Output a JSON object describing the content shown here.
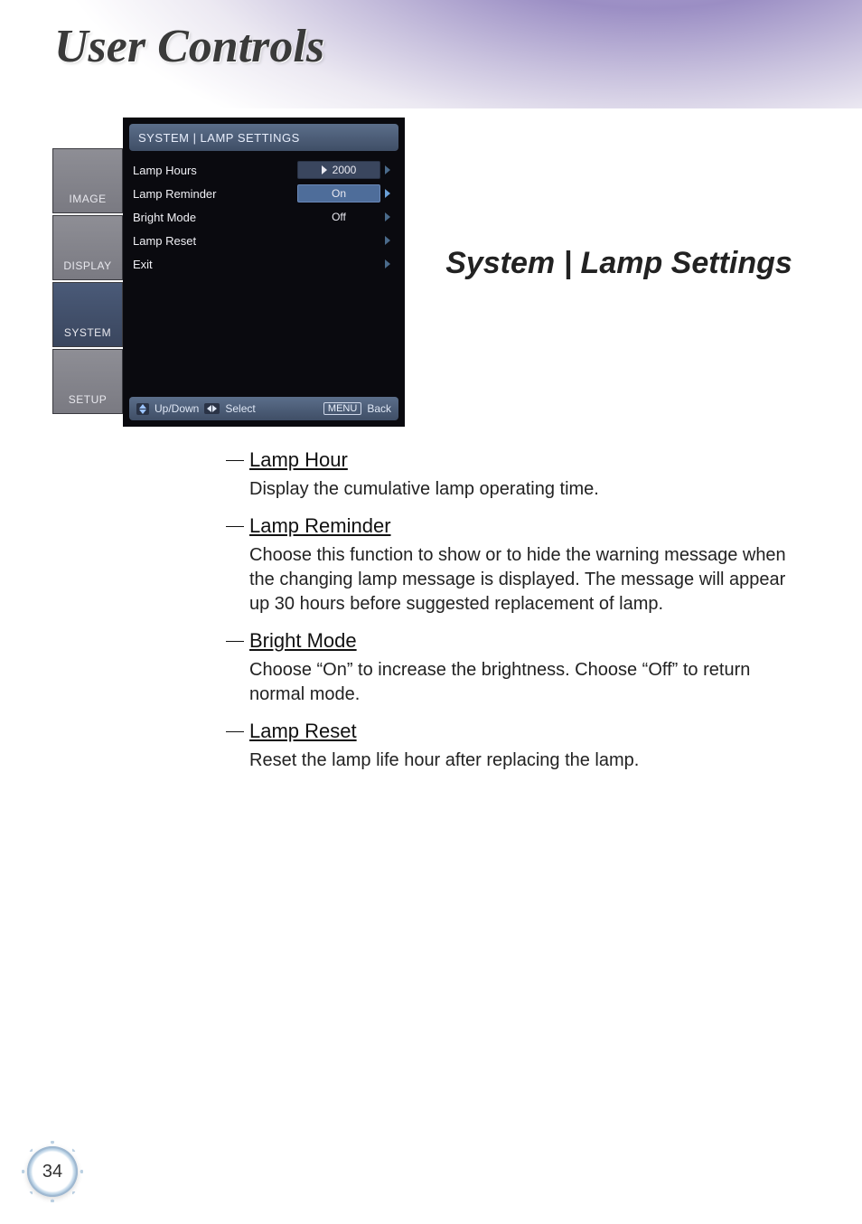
{
  "page": {
    "title": "User Controls",
    "number": "34"
  },
  "osd": {
    "title": "SYSTEM | LAMP SETTINGS",
    "tabs": [
      {
        "label": "IMAGE",
        "active": false
      },
      {
        "label": "DISPLAY",
        "active": false
      },
      {
        "label": "SYSTEM",
        "active": true
      },
      {
        "label": "SETUP",
        "active": false
      }
    ],
    "rows": [
      {
        "label": "Lamp Hours",
        "value": "2000",
        "style": "box",
        "marker": true
      },
      {
        "label": "Lamp Reminder",
        "value": "On",
        "style": "box",
        "selected": true
      },
      {
        "label": "Bright Mode",
        "value": "Off",
        "style": "plain"
      },
      {
        "label": "Lamp Reset",
        "value": "",
        "style": "none"
      },
      {
        "label": "Exit",
        "value": "",
        "style": "none"
      }
    ],
    "footer": {
      "updown": "Up/Down",
      "select": "Select",
      "menu": "MENU",
      "back": "Back"
    }
  },
  "section_title": "System | Lamp Settings",
  "descriptions": [
    {
      "heading": "Lamp Hour",
      "body": "Display the cumulative lamp operating time."
    },
    {
      "heading": "Lamp Reminder",
      "body": "Choose this function to show or to hide the warning message when the changing lamp message is displayed. The message will appear up 30 hours before suggested replacement of lamp."
    },
    {
      "heading": "Bright Mode",
      "body": "Choose “On” to increase the brightness. Choose “Off” to return normal mode."
    },
    {
      "heading": "Lamp Reset",
      "body": "Reset the lamp life hour after replacing the lamp."
    }
  ]
}
